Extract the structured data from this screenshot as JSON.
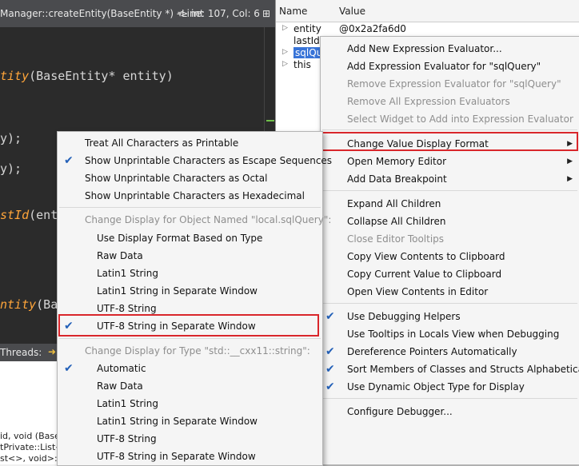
{
  "editor": {
    "signature": "Manager::createEntity(BaseEntity *) -> int",
    "line_col": "Line: 107, Col: 6",
    "code_lines": [
      {
        "fn": "tity",
        "rest": "(BaseEntity* entity)"
      },
      {
        "fn": "",
        "rest": "y);"
      },
      {
        "fn": "",
        "rest": "y);"
      },
      {
        "fn": "stId",
        "rest": "(ent"
      },
      {
        "fn": "ntity",
        "rest": "(Ba"
      }
    ],
    "threads_label": "Threads:",
    "bottom_lines": [
      "id, void (Base",
      "tPrivate::List<",
      "st<>, void>::i"
    ]
  },
  "locals": {
    "col_name": "Name",
    "col_value": "Value",
    "rows": [
      {
        "name": "entity",
        "value": "@0x2a2fa6d0",
        "expandable": true
      },
      {
        "name": "lastId",
        "value": "",
        "expandable": false
      },
      {
        "name": "sqlQue",
        "value": "",
        "expandable": true
      },
      {
        "name": "this",
        "value": "",
        "expandable": true
      }
    ]
  },
  "context_menu": {
    "items": [
      {
        "label": "Add New Expression Evaluator...",
        "enabled": true
      },
      {
        "label": "Add Expression Evaluator for \"sqlQuery\"",
        "enabled": true
      },
      {
        "label": "Remove Expression Evaluator for \"sqlQuery\"",
        "enabled": false
      },
      {
        "label": "Remove All Expression Evaluators",
        "enabled": false
      },
      {
        "label": "Select Widget to Add into Expression Evaluator",
        "enabled": false
      },
      {
        "label": "Change Value Display Format",
        "enabled": true,
        "submenu": true
      },
      {
        "label": "Open Memory Editor",
        "enabled": true,
        "submenu": true
      },
      {
        "label": "Add Data Breakpoint",
        "enabled": true,
        "submenu": true
      },
      {
        "label": "Expand All Children",
        "enabled": true
      },
      {
        "label": "Collapse All Children",
        "enabled": true
      },
      {
        "label": "Close Editor Tooltips",
        "enabled": false
      },
      {
        "label": "Copy View Contents to Clipboard",
        "enabled": true
      },
      {
        "label": "Copy Current Value to Clipboard",
        "enabled": true
      },
      {
        "label": "Open View Contents in Editor",
        "enabled": true
      },
      {
        "label": "Use Debugging Helpers",
        "enabled": true,
        "checked": true
      },
      {
        "label": "Use Tooltips in Locals View when Debugging",
        "enabled": true,
        "checked": false
      },
      {
        "label": "Dereference Pointers Automatically",
        "enabled": true,
        "checked": true
      },
      {
        "label": "Sort Members of Classes and Structs Alphabetically",
        "enabled": true,
        "checked": true
      },
      {
        "label": "Use Dynamic Object Type for Display",
        "enabled": true,
        "checked": true
      },
      {
        "label": "Configure Debugger...",
        "enabled": true
      }
    ]
  },
  "format_submenu": {
    "items": [
      {
        "label": "Treat All Characters as Printable",
        "checked": false
      },
      {
        "label": "Show Unprintable Characters as Escape Sequences",
        "checked": true
      },
      {
        "label": "Show Unprintable Characters as Octal",
        "checked": false
      },
      {
        "label": "Show Unprintable Characters as Hexadecimal",
        "checked": false
      },
      {
        "label": "Change Display for Object Named \"local.sqlQuery\":",
        "header": true
      },
      {
        "label": "Use Display Format Based on Type",
        "checked": false
      },
      {
        "label": "Raw Data",
        "checked": false
      },
      {
        "label": "Latin1 String",
        "checked": false
      },
      {
        "label": "Latin1 String in Separate Window",
        "checked": false
      },
      {
        "label": "UTF-8 String",
        "checked": false
      },
      {
        "label": "UTF-8 String in Separate Window",
        "checked": true
      },
      {
        "label": "Change Display for Type \"std::__cxx11::string\":",
        "header": true
      },
      {
        "label": "Automatic",
        "checked": true
      },
      {
        "label": "Raw Data",
        "checked": false
      },
      {
        "label": "Latin1 String",
        "checked": false
      },
      {
        "label": "Latin1 String in Separate Window",
        "checked": false
      },
      {
        "label": "UTF-8 String",
        "checked": false
      },
      {
        "label": "UTF-8 String in Separate Window",
        "checked": false
      }
    ]
  },
  "icons": {
    "checkmark": "check-icon",
    "submenu_arrow": "triangle-right-icon",
    "expand": "expand-arrow-icon"
  },
  "colors": {
    "highlight_box": "#d9262b",
    "check": "#2360b8",
    "code_function": "#ffa53a"
  }
}
